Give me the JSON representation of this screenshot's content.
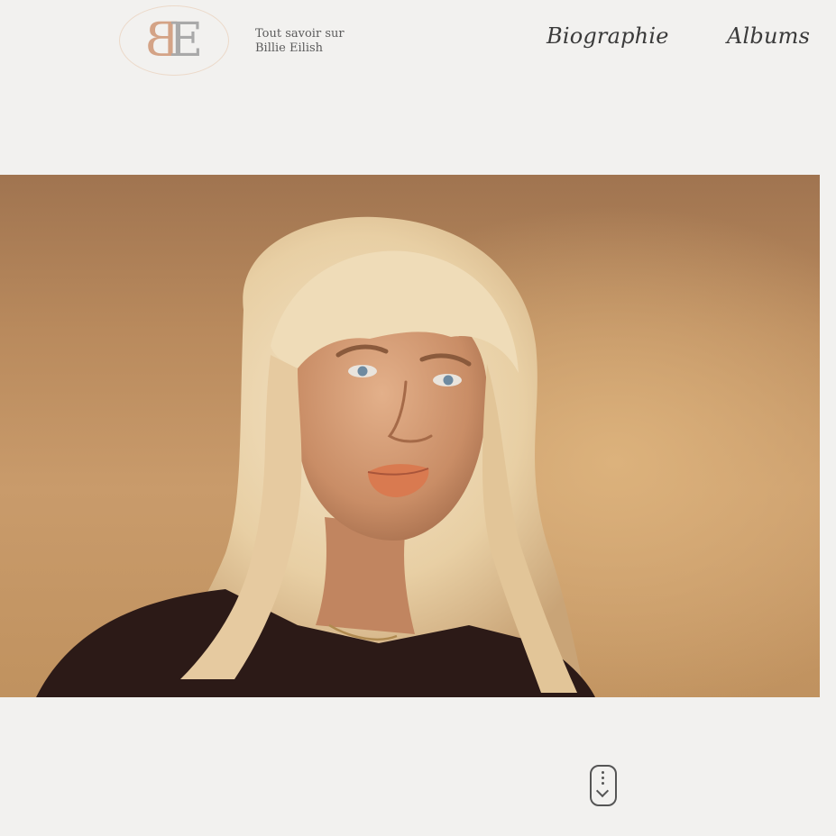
{
  "header": {
    "logo": {
      "letters": [
        "B",
        "E"
      ],
      "colors": {
        "b": "#d4a386",
        "e": "#a9a9a9",
        "ring": "#ecd9c9"
      }
    },
    "tagline": {
      "line1": "Tout savoir sur",
      "line2": "Billie Eilish"
    },
    "nav": [
      {
        "label": "Biographie"
      },
      {
        "label": "Albums"
      }
    ]
  },
  "hero": {
    "background": "#c49462"
  },
  "scroll_indicator": {
    "icon": "scroll-down-icon"
  },
  "colors": {
    "page_bg": "#f2f1ef",
    "text": "#3a3a3a"
  }
}
